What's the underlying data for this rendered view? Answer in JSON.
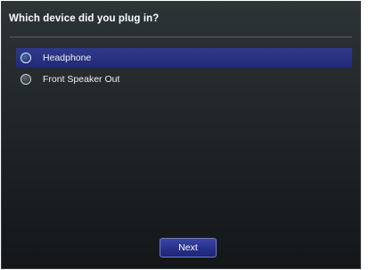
{
  "dialog": {
    "title": "Which device did you plug in?",
    "options": [
      {
        "label": "Headphone",
        "selected": true
      },
      {
        "label": "Front Speaker Out",
        "selected": false
      }
    ],
    "next_label": "Next"
  },
  "colors": {
    "background_top": "#2e3436",
    "background_bottom": "#14171a",
    "selection": "#2f3a8c",
    "button": "#27318a",
    "text": "#ffffff"
  }
}
